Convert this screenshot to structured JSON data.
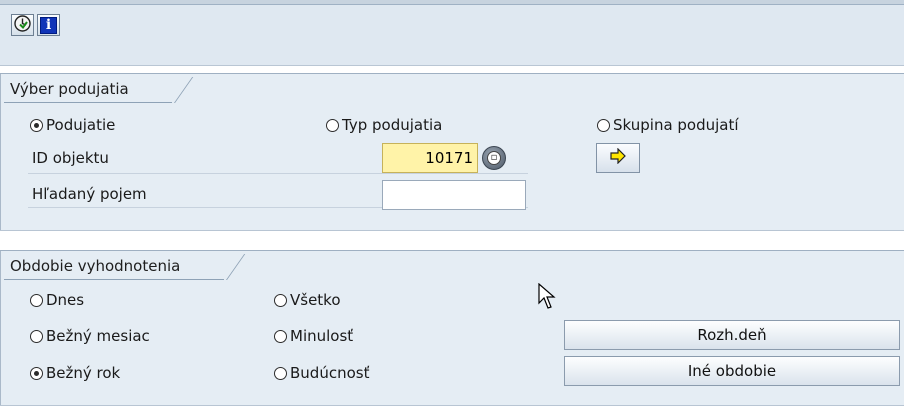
{
  "toolbar": {
    "execute_icon": "execute-clock-icon",
    "info_icon": "info-icon",
    "info_glyph": "i"
  },
  "selection_group": {
    "title": "Výber podujatia",
    "radios": {
      "event": {
        "label": "Podujatie",
        "selected": true
      },
      "event_type": {
        "label": "Typ podujatia",
        "selected": false
      },
      "event_group": {
        "label": "Skupina podujatí",
        "selected": false
      }
    },
    "object_id": {
      "label": "ID objektu",
      "value": "10171"
    },
    "search_term": {
      "label": "Hľadaný pojem",
      "value": ""
    }
  },
  "period_group": {
    "title": "Obdobie vyhodnotenia",
    "radios": {
      "today": {
        "label": "Dnes",
        "selected": false
      },
      "all": {
        "label": "Všetko",
        "selected": false
      },
      "current_month": {
        "label": "Bežný mesiac",
        "selected": false
      },
      "past": {
        "label": "Minulosť",
        "selected": false
      },
      "current_year": {
        "label": "Bežný rok",
        "selected": true
      },
      "future": {
        "label": "Budúcnosť",
        "selected": false
      }
    },
    "buttons": {
      "key_date": "Rozh.deň",
      "other_period": "Iné obdobie"
    }
  },
  "colors": {
    "group_bg": "#e5edf4",
    "required_field": "#fff3a8"
  }
}
